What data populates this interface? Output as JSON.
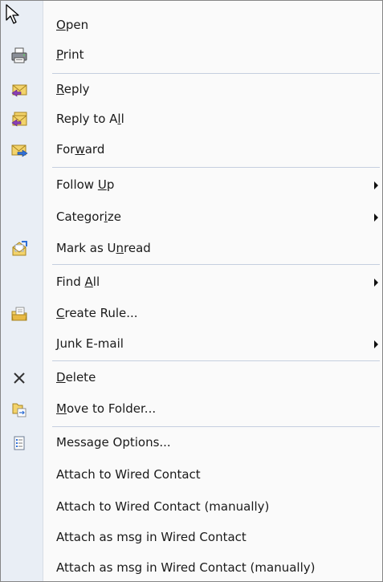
{
  "menu": {
    "items": [
      {
        "pre": "",
        "mn": "O",
        "post": "pen",
        "icon": ""
      },
      {
        "pre": "",
        "mn": "P",
        "post": "rint",
        "icon": "printer-icon"
      },
      {
        "pre": "",
        "mn": "R",
        "post": "eply",
        "icon": "reply-icon"
      },
      {
        "pre": "Reply to A",
        "mn": "l",
        "post": "l",
        "icon": "reply-all-icon"
      },
      {
        "pre": "For",
        "mn": "w",
        "post": "ard",
        "icon": "forward-icon"
      },
      {
        "pre": "Follow ",
        "mn": "U",
        "post": "p",
        "icon": ""
      },
      {
        "pre": "Categor",
        "mn": "i",
        "post": "ze",
        "icon": ""
      },
      {
        "pre": "Mark as U",
        "mn": "n",
        "post": "read",
        "icon": "mark-unread-icon"
      },
      {
        "pre": "Find ",
        "mn": "A",
        "post": "ll",
        "icon": ""
      },
      {
        "pre": "",
        "mn": "C",
        "post": "reate Rule...",
        "icon": "create-rule-icon"
      },
      {
        "pre": "",
        "mn": "J",
        "post": "unk E-mail",
        "icon": ""
      },
      {
        "pre": "",
        "mn": "D",
        "post": "elete",
        "icon": "delete-icon"
      },
      {
        "pre": "",
        "mn": "M",
        "post": "ove to Folder...",
        "icon": "move-folder-icon"
      },
      {
        "pre": "Message Options...",
        "mn": "",
        "post": "",
        "icon": "message-options-icon"
      },
      {
        "pre": "Attach to Wired Contact",
        "mn": "",
        "post": "",
        "icon": ""
      },
      {
        "pre": "Attach to Wired Contact (manually)",
        "mn": "",
        "post": "",
        "icon": ""
      },
      {
        "pre": "Attach as msg in Wired Contact",
        "mn": "",
        "post": "",
        "icon": ""
      },
      {
        "pre": "Attach as msg in Wired Contact (manually)",
        "mn": "",
        "post": "",
        "icon": ""
      }
    ]
  },
  "colors": {
    "gutter": "#e9eef5",
    "separator": "#c5cfdf",
    "border": "#868686",
    "envelope": "#f3d36b",
    "arrow_purple": "#8a3fb5",
    "arrow_blue": "#2f6fd6"
  }
}
